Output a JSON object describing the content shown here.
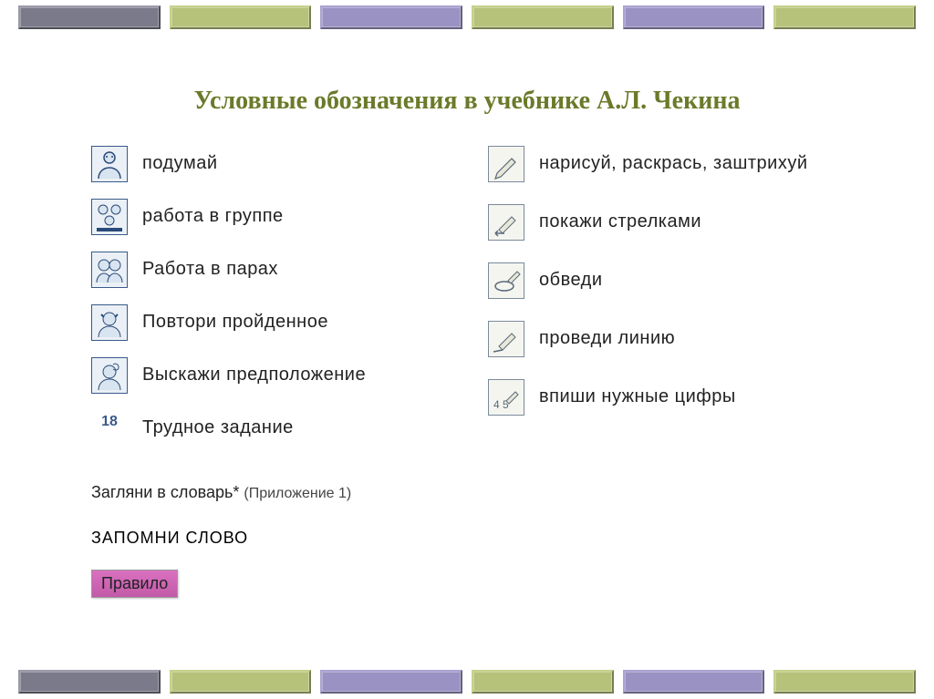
{
  "title": "Условные обозначения в учебнике А.Л. Чекина",
  "left": {
    "items": [
      {
        "label": "подумай",
        "icon": "think-person"
      },
      {
        "label": "работа в группе",
        "icon": "group"
      },
      {
        "label": "Работа в парах",
        "icon": "pair"
      },
      {
        "label": "Повтори пройденное",
        "icon": "review"
      },
      {
        "label": "Выскажи предположение",
        "icon": "suggest"
      }
    ],
    "hard_number": "18",
    "hard_label": "Трудное задание"
  },
  "right": {
    "items": [
      {
        "label": "нарисуй, раскрась, заштрихуй",
        "icon": "pencil"
      },
      {
        "label": "покажи стрелками",
        "icon": "arrow-pencil"
      },
      {
        "label": "обведи",
        "icon": "circle-pencil"
      },
      {
        "label": "проведи линию",
        "icon": "line-pencil"
      },
      {
        "label": "впиши нужные цифры",
        "icon": "numbers-pencil"
      }
    ]
  },
  "footer": {
    "dictionary": "Загляни в словарь*",
    "appendix": "(Приложение 1)",
    "remember": "ЗАПОМНИ СЛОВО",
    "rule": "Правило"
  }
}
